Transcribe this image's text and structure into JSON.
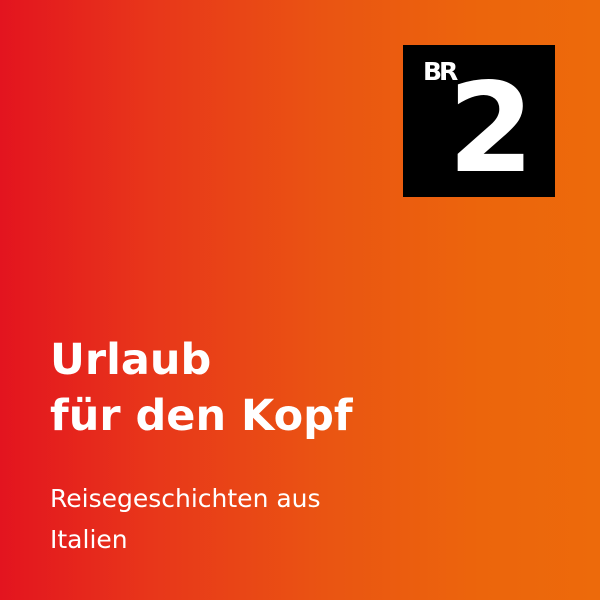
{
  "logo": {
    "brand": "BR",
    "channel": "2"
  },
  "title": {
    "line1": "Urlaub",
    "line2": "für den Kopf"
  },
  "subtitle": {
    "line1": "Reisegeschichten aus",
    "line2": "Italien"
  },
  "colors": {
    "gradient_start": "#e3141f",
    "gradient_end": "#ed6a0b",
    "logo_background": "#000000",
    "text": "#ffffff"
  }
}
